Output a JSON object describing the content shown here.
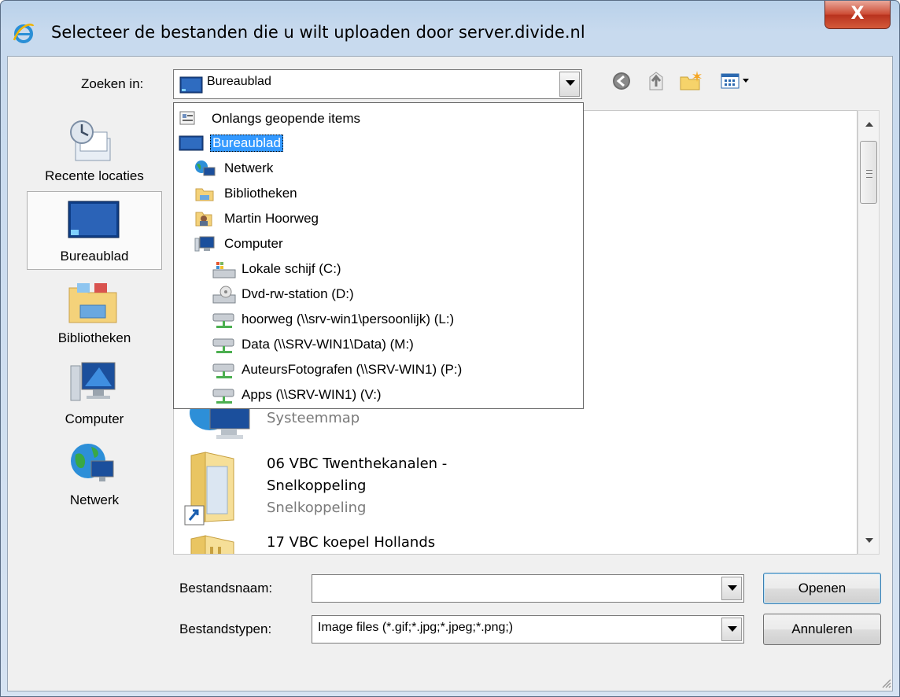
{
  "window": {
    "title": "Selecteer de bestanden die u wilt uploaden door server.divide.nl",
    "close_label": "X"
  },
  "lookin": {
    "label": "Zoeken in:",
    "value": "Bureaublad"
  },
  "toolbar_icons": [
    "back-icon",
    "up-folder-icon",
    "new-folder-icon",
    "view-menu-icon"
  ],
  "places": [
    {
      "label": "Recente locaties",
      "icon": "recent-locations-icon"
    },
    {
      "label": "Bureaublad",
      "icon": "desktop-icon",
      "selected": true
    },
    {
      "label": "Bibliotheken",
      "icon": "libraries-icon"
    },
    {
      "label": "Computer",
      "icon": "computer-icon"
    },
    {
      "label": "Netwerk",
      "icon": "network-icon"
    }
  ],
  "dropdown_items": [
    {
      "label": "Onlangs geopende items",
      "icon": "recent-items-icon",
      "level": 0
    },
    {
      "label": "Bureaublad",
      "icon": "desktop-icon",
      "level": 0,
      "highlighted": true
    },
    {
      "label": "Netwerk",
      "icon": "network-icon",
      "level": 1
    },
    {
      "label": "Bibliotheken",
      "icon": "libraries-icon",
      "level": 1
    },
    {
      "label": "Martin Hoorweg",
      "icon": "user-folder-icon",
      "level": 1
    },
    {
      "label": "Computer",
      "icon": "computer-icon",
      "level": 1
    },
    {
      "label": "Lokale schijf (C:)",
      "icon": "local-disk-icon",
      "level": 2
    },
    {
      "label": "Dvd-rw-station (D:)",
      "icon": "dvd-drive-icon",
      "level": 2
    },
    {
      "label": "hoorweg (\\\\srv-win1\\persoonlijk) (L:)",
      "icon": "network-drive-icon",
      "level": 2
    },
    {
      "label": "Data (\\\\SRV-WIN1\\Data) (M:)",
      "icon": "network-drive-icon",
      "level": 2
    },
    {
      "label": "AuteursFotografen (\\\\SRV-WIN1) (P:)",
      "icon": "network-drive-icon",
      "level": 2
    },
    {
      "label": "Apps (\\\\SRV-WIN1) (V:)",
      "icon": "network-drive-icon",
      "level": 2
    }
  ],
  "files": [
    {
      "name": "",
      "type": "Systeemmap",
      "icon": "computer-icon"
    },
    {
      "name_line1": "06 VBC Twenthekanalen -",
      "name_line2": "Snelkoppeling",
      "type": "Snelkoppeling",
      "icon": "folder-shortcut-icon"
    },
    {
      "name": "17 VBC koepel Hollands",
      "icon": "folder-icon"
    }
  ],
  "filename": {
    "label": "Bestandsnaam:",
    "value": ""
  },
  "filetype": {
    "label": "Bestandstypen:",
    "value": "Image files (*.gif;*.jpg;*.jpeg;*.png;)"
  },
  "buttons": {
    "open": "Openen",
    "cancel": "Annuleren"
  }
}
